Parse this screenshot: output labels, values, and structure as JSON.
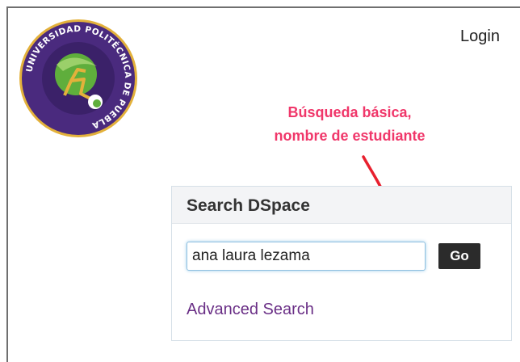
{
  "header": {
    "logo_text": "UNIVERSIDAD POLITÉCNICA DE PUEBLA",
    "login_label": "Login"
  },
  "annotation": {
    "line1": "Búsqueda básica,",
    "line2": "nombre de estudiante",
    "color": "#f0376a"
  },
  "search": {
    "title": "Search DSpace",
    "query_value": "ana laura lezama",
    "go_label": "Go",
    "advanced_label": "Advanced Search"
  },
  "colors": {
    "logo_purple": "#4a2a7e",
    "logo_gold": "#e3b13b",
    "link_purple": "#6a2f86",
    "button_dark": "#2b2b2b"
  }
}
